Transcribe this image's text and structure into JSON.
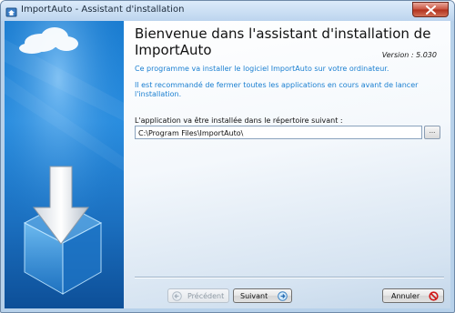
{
  "window": {
    "title": "ImportAuto - Assistant d'installation"
  },
  "header": {
    "heading": "Bienvenue dans l'assistant d'installation de ImportAuto",
    "version": "Version : 5.030"
  },
  "info": {
    "line1": "Ce programme va installer le logiciel ImportAuto sur votre ordinateur.",
    "line2": "Il est recommandé de fermer toutes les applications en cours avant de lancer l'installation."
  },
  "install": {
    "dir_label": "L'application va être installée dans le répertoire suivant :",
    "dir_value": "C:\\Program Files\\ImportAuto\\",
    "browse_label": "..."
  },
  "buttons": {
    "previous": "Précédent",
    "next": "Suivant",
    "cancel": "Annuler"
  },
  "colors": {
    "accent_text": "#1a7fd1",
    "sidebar_blue": "#1a7cd0",
    "cancel_icon": "#d01818"
  },
  "icons": {
    "app": "app-icon",
    "close": "close-icon",
    "sidebar_art": "install-box-arrow-illustration",
    "previous": "arrow-left-icon",
    "next": "arrow-right-icon",
    "cancel": "prohibited-icon"
  }
}
